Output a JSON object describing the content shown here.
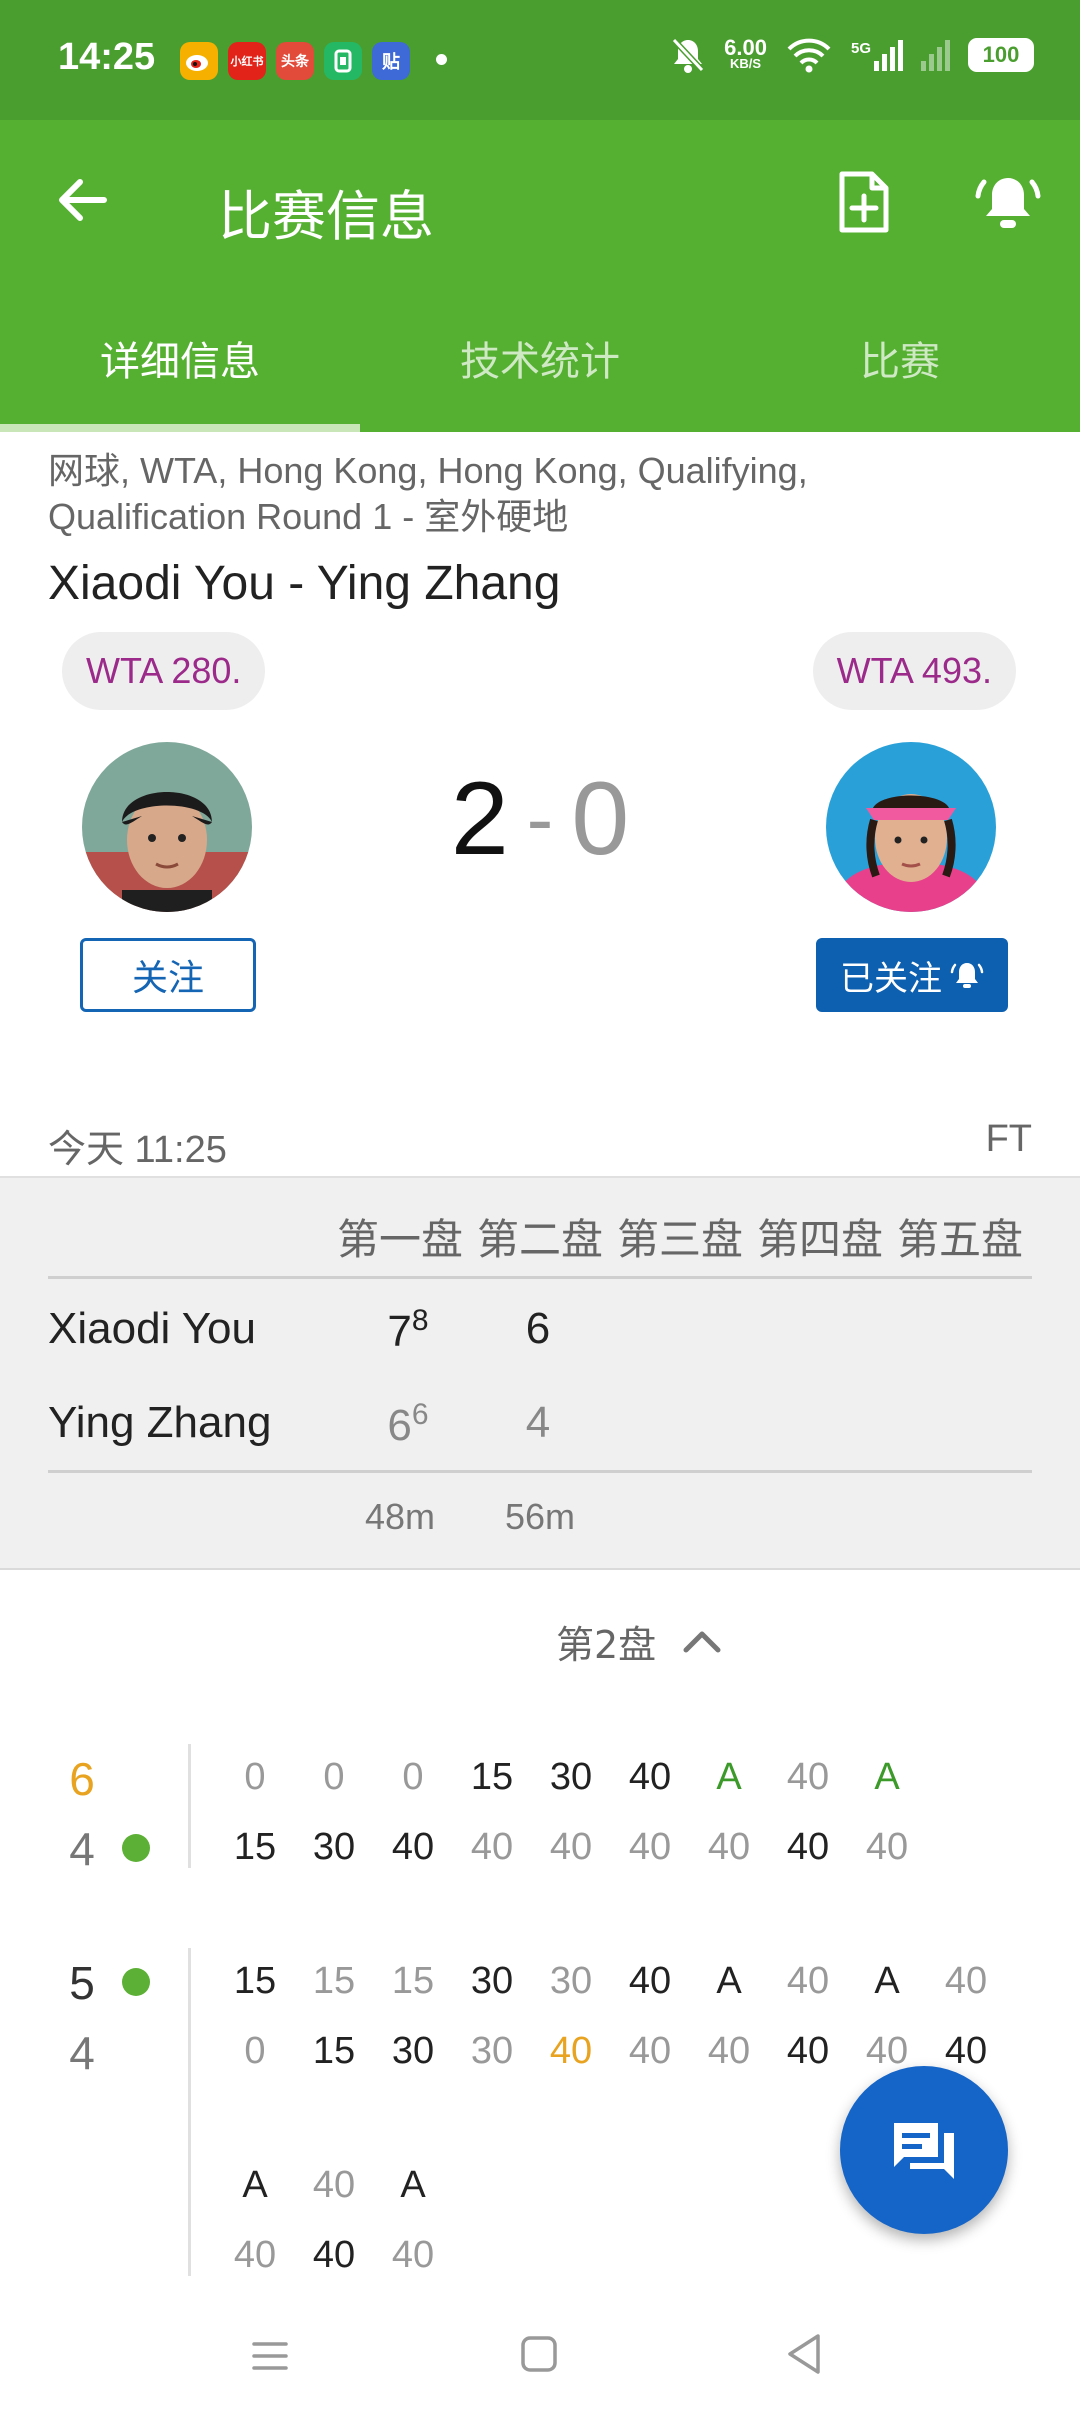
{
  "status_bar": {
    "time": "14:25",
    "apps": [
      {
        "icon": "weibo-icon",
        "label": "",
        "color": "#f6b100"
      },
      {
        "icon": "xiaohongshu-icon",
        "label": "小红书",
        "color": "#e2231a"
      },
      {
        "icon": "toutiao-icon",
        "label": "头条",
        "color": "#e24a3a"
      },
      {
        "icon": "app-green-icon",
        "label": "",
        "color": "#25b864"
      },
      {
        "icon": "tieba-icon",
        "label": "贴",
        "color": "#3d6ad6"
      }
    ],
    "net_speed": "6.00",
    "net_speed_unit": "KB/S",
    "network": "5G",
    "battery": "100"
  },
  "app_bar": {
    "title": "比赛信息"
  },
  "tabs": [
    {
      "label": "详细信息",
      "active": true
    },
    {
      "label": "技术统计",
      "active": false
    },
    {
      "label": "比赛",
      "active": false
    }
  ],
  "match": {
    "competition_line1": "网球, WTA, Hong Kong, Hong Kong, Qualifying,",
    "competition_line2": "Qualification Round 1 - 室外硬地",
    "title": "Xiaodi You - Ying Zhang",
    "home_rank": "WTA 280.",
    "away_rank": "WTA 493.",
    "home_score": "2",
    "away_score": "0",
    "follow_label": "关注",
    "followed_label": "已关注",
    "time": "今天 11:25",
    "status": "FT"
  },
  "sets": {
    "headers": [
      "第一盘",
      "第二盘",
      "第三盘",
      "第四盘",
      "第五盘"
    ],
    "players": [
      {
        "name": "Xiaodi You",
        "set1": "7",
        "set1_tb": "8",
        "set2": "6"
      },
      {
        "name": "Ying Zhang",
        "set1": "6",
        "set1_tb": "6",
        "set2": "4"
      }
    ],
    "durations": [
      "48m",
      "56m"
    ]
  },
  "point_by_point": {
    "selector_label": "第2盘",
    "games": [
      {
        "home_games": "6",
        "away_games": "4",
        "home_points": [
          "0",
          "0",
          "0",
          "15",
          "30",
          "40",
          "A",
          "40",
          "A"
        ],
        "away_points": [
          "15",
          "30",
          "40",
          "40",
          "40",
          "40",
          "40",
          "40",
          "40"
        ]
      },
      {
        "home_games": "5",
        "away_games": "4",
        "home_points": [
          "15",
          "15",
          "15",
          "30",
          "30",
          "40",
          "A",
          "40",
          "A",
          "40"
        ],
        "away_points": [
          "0",
          "15",
          "30",
          "30",
          "40",
          "40",
          "40",
          "40",
          "40",
          "40"
        ],
        "home_points_2": [
          "A",
          "40",
          "A"
        ],
        "away_points_2": [
          "40",
          "40",
          "40"
        ]
      }
    ]
  }
}
